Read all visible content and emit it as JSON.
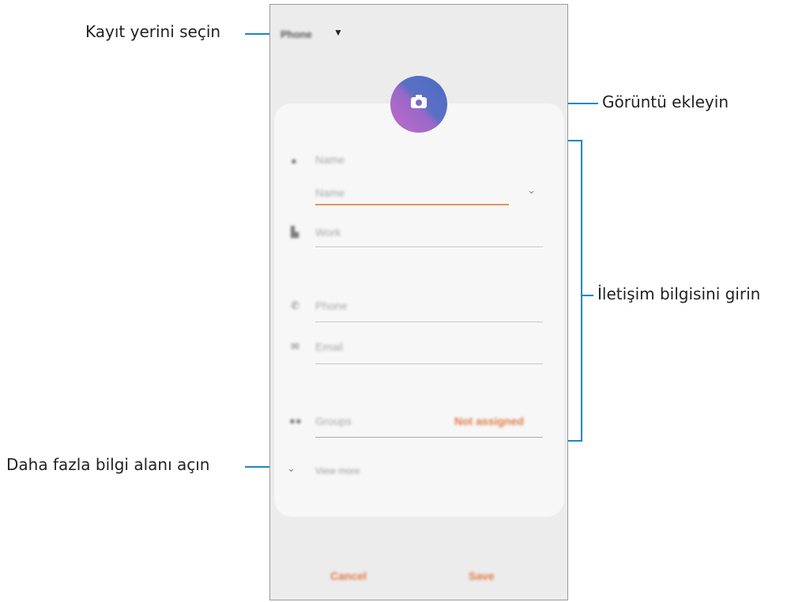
{
  "callouts": {
    "storage": "Kayıt yerini seçin",
    "image": "Görüntü ekleyin",
    "contact_info": "İletişim bilgisini girin",
    "more_fields": "Daha fazla bilgi alanı açın"
  },
  "form": {
    "storage_value": "Phone",
    "name_label": "Name",
    "name_placeholder": "Name",
    "work_label": "Work",
    "phone_label": "Phone",
    "email_label": "Email",
    "groups_label": "Groups",
    "groups_value": "Not assigned",
    "view_more": "View more"
  },
  "buttons": {
    "cancel": "Cancel",
    "save": "Save"
  },
  "colors": {
    "accent": "#e07a45",
    "callout_line": "#1a86c7"
  }
}
